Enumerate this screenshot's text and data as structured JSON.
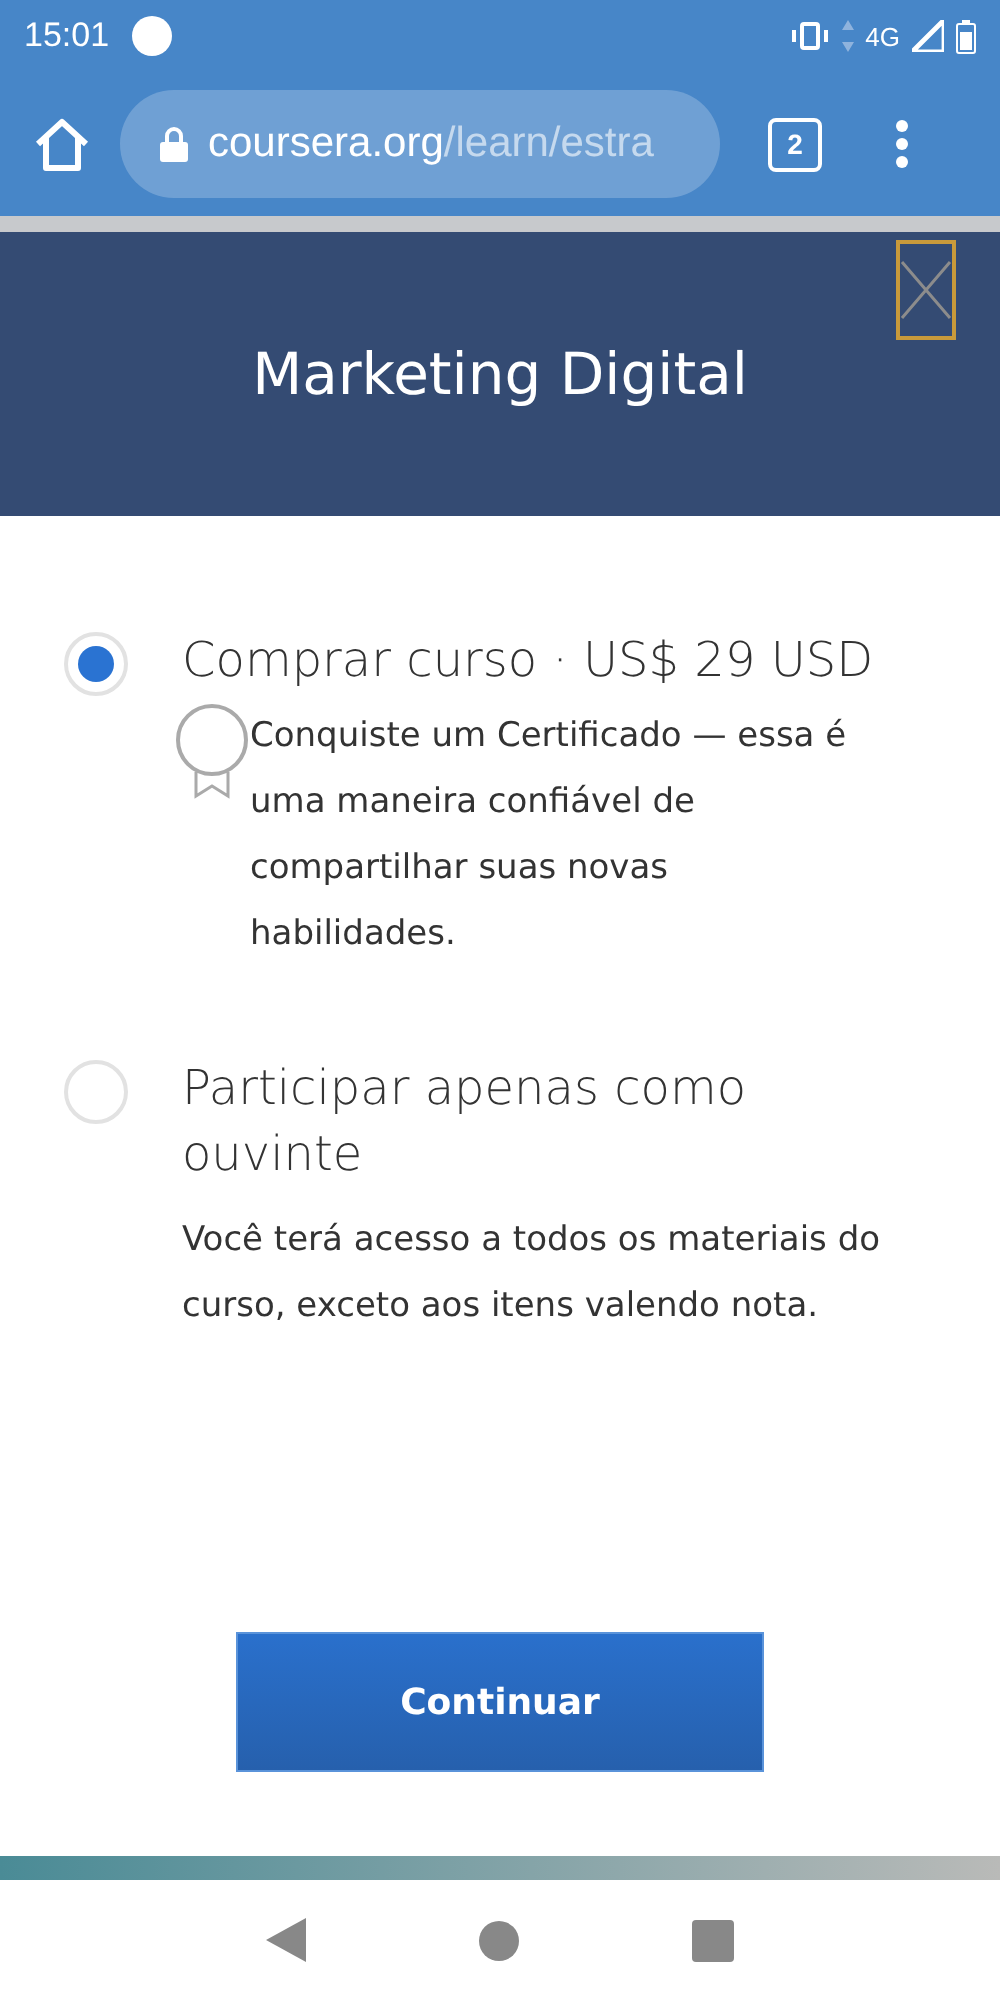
{
  "status_bar": {
    "time": "15:01",
    "network": "4G"
  },
  "browser": {
    "url_host": "coursera.org",
    "url_path": "/learn/estra",
    "tab_count": "2"
  },
  "modal": {
    "title": "Marketing Digital",
    "options": [
      {
        "kind": "certificate",
        "title": "Comprar curso · US$ 29 USD",
        "description": "Conquiste um Certificado — essa é uma maneira confiável de compartilhar suas novas habilidades.",
        "selected": true
      },
      {
        "kind": "plain",
        "title": "Participar apenas como ouvinte",
        "description": "Você terá acesso a todos os materiais do curso, exceto aos itens valendo nota.",
        "selected": false
      }
    ],
    "button": "Continuar"
  }
}
